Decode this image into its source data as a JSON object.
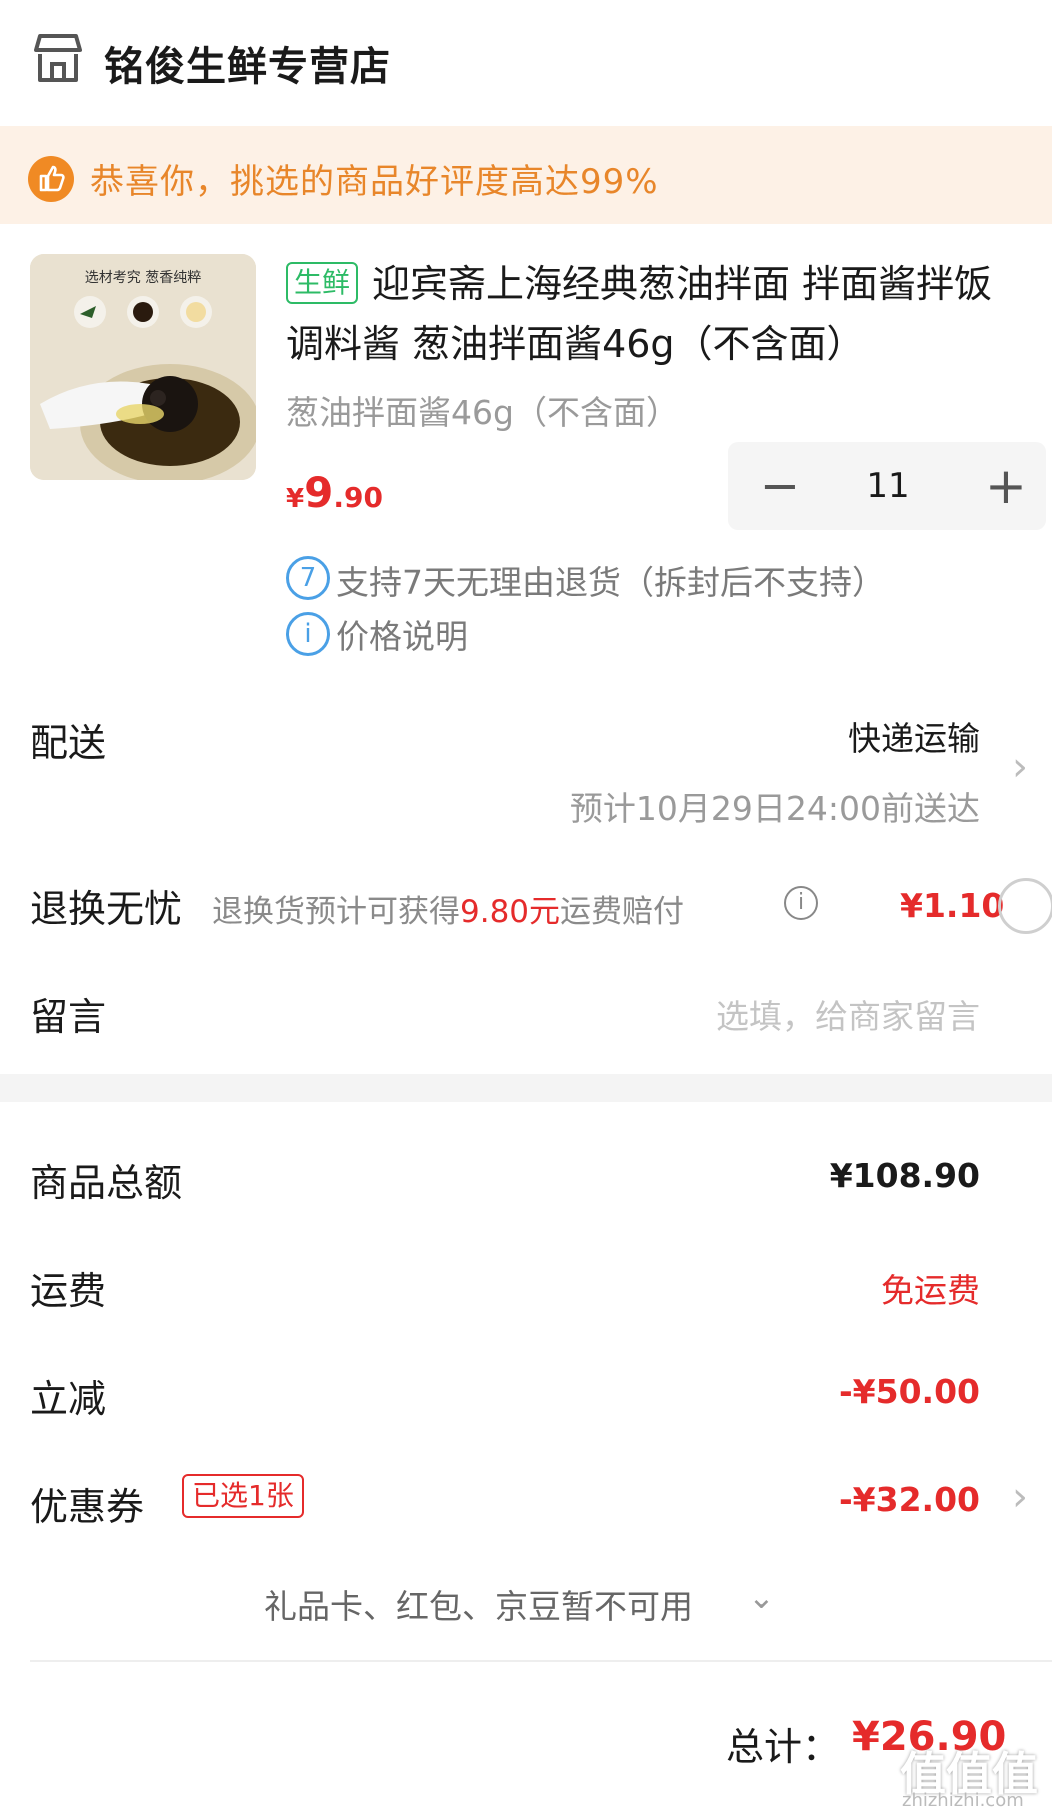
{
  "store": {
    "name": "铭俊生鲜专营店"
  },
  "banner": {
    "text": "恭喜你，挑选的商品好评度高达99%"
  },
  "product": {
    "tag": "生鲜",
    "title": "迎宾斋上海经典葱油拌面 拌面酱拌饭调料酱 葱油拌面酱46g（不含面）",
    "spec": "葱油拌面酱46g（不含面）",
    "image_caption": "选材考究 葱香纯粹",
    "price_symbol": "¥",
    "price_int": "9",
    "price_dec": ".90",
    "quantity": "11",
    "services": [
      {
        "icon": "7",
        "text": "支持7天无理由退货（拆封后不支持）"
      },
      {
        "icon": "i",
        "text": "价格说明"
      }
    ]
  },
  "delivery": {
    "label": "配送",
    "method": "快递运输",
    "eta": "预计10月29日24:00前送达"
  },
  "return_worry": {
    "label": "退换无忧",
    "desc_prefix": "退换货预计可获得",
    "desc_amount": "9.80元",
    "desc_suffix": "运费赔付",
    "price": "¥1.10"
  },
  "message": {
    "label": "留言",
    "placeholder": "选填，给商家留言"
  },
  "summary": {
    "goods_total_label": "商品总额",
    "goods_total": "¥108.90",
    "shipping_label": "运费",
    "shipping": "免运费",
    "discount_label": "立减",
    "discount": "-¥50.00",
    "coupon_label": "优惠券",
    "coupon_tag": "已选1张",
    "coupon": "-¥32.00",
    "unavailable": "礼品卡、红包、京豆暂不可用",
    "total_label": "总计：",
    "total": "¥26.90"
  },
  "watermark": {
    "main": "值值值",
    "sub": "zhizhizhi.com"
  },
  "colors": {
    "accent_red": "#e52b2b",
    "banner_orange": "#e8862a",
    "fresh_green": "#2dbb66",
    "info_blue": "#4aa0e6"
  }
}
